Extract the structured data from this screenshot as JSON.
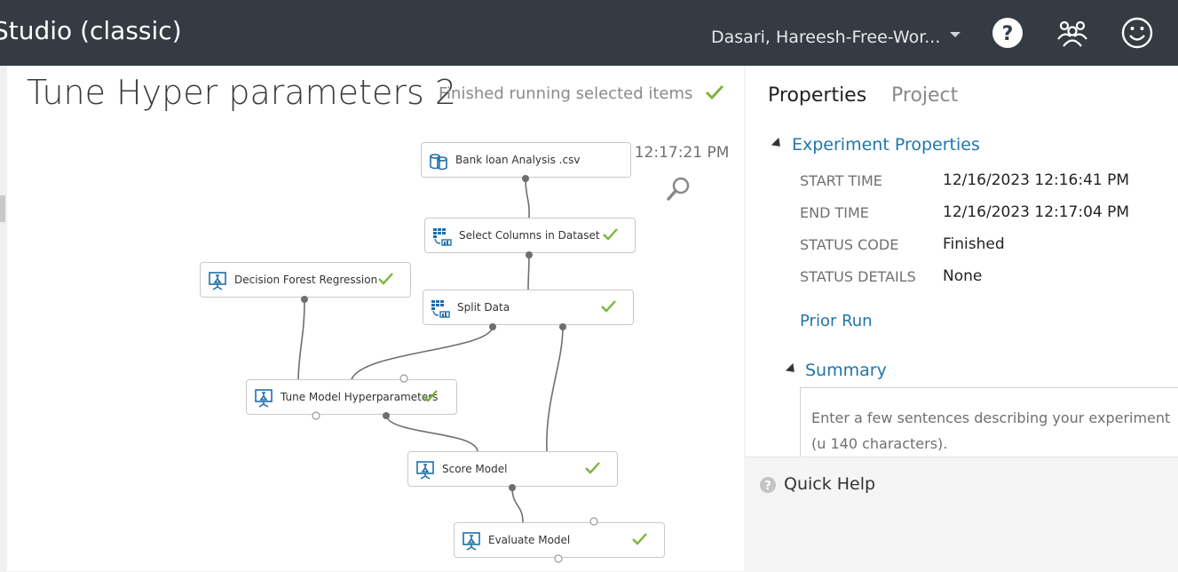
{
  "header": {
    "app_title": "Studio (classic)",
    "account": "Dasari, Hareesh-Free-Wor..."
  },
  "experiment": {
    "title": "Tune Hyper parameters 2",
    "run_status": "Finished running selected items",
    "draft_status": "Draft saved at 12:17:21 PM"
  },
  "modules": [
    {
      "label": "Bank loan Analysis .csv",
      "icon": "dataset-icon",
      "completed": false
    },
    {
      "label": "Select Columns in Dataset",
      "icon": "data-transform-icon",
      "completed": true
    },
    {
      "label": "Decision Forest Regression",
      "icon": "model-icon",
      "completed": true
    },
    {
      "label": "Split Data",
      "icon": "data-transform-icon",
      "completed": true
    },
    {
      "label": "Tune Model Hyperparameters",
      "icon": "model-icon",
      "completed": true
    },
    {
      "label": "Score Model",
      "icon": "model-icon",
      "completed": true
    },
    {
      "label": "Evaluate Model",
      "icon": "model-icon",
      "completed": true
    }
  ],
  "panel": {
    "tabs": [
      "Properties",
      "Project"
    ],
    "experiment_properties": {
      "heading": "Experiment Properties",
      "rows": [
        {
          "key": "START TIME",
          "value": "12/16/2023 12:16:41 PM"
        },
        {
          "key": "END TIME",
          "value": "12/16/2023 12:17:04 PM"
        },
        {
          "key": "STATUS CODE",
          "value": "Finished"
        },
        {
          "key": "STATUS DETAILS",
          "value": "None"
        }
      ],
      "prior_run": "Prior Run"
    },
    "summary": {
      "heading": "Summary",
      "placeholder": "Enter a few sentences describing your experiment (u 140 characters)."
    },
    "quick_help": "Quick Help"
  },
  "colors": {
    "header_bg": "#343b43",
    "accent_link": "#2176a8",
    "check_green": "#7cb53a",
    "module_icon": "#1f6fa8"
  }
}
